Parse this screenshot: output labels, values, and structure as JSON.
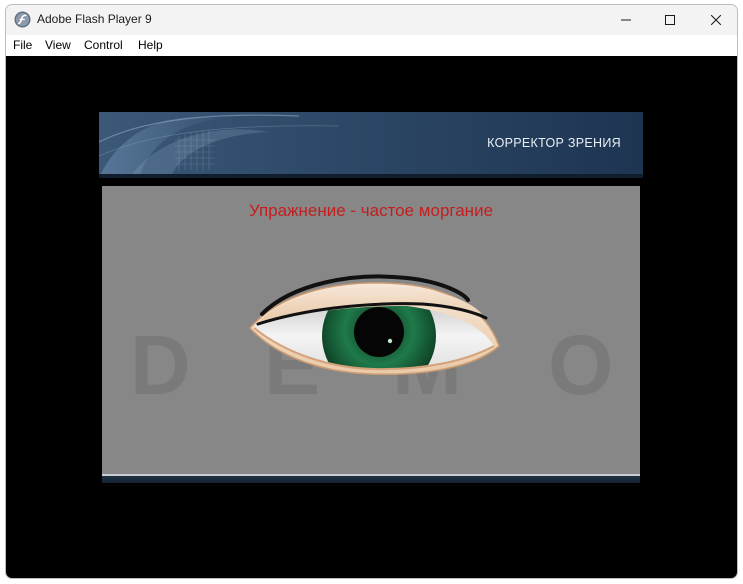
{
  "window": {
    "title": "Adobe Flash Player 9"
  },
  "menu": {
    "items": [
      "File",
      "View",
      "Control",
      "Help"
    ]
  },
  "flash": {
    "banner_title": "КОРРЕКТОР ЗРЕНИЯ",
    "exercise_title": "Упражнение - частое моргание",
    "watermark": [
      "D",
      "E",
      "M",
      "O"
    ]
  },
  "colors": {
    "stage_background": "#878787",
    "title_red": "#c41e1e",
    "iris_green": "#1f7a4a",
    "banner_blue": "#2c4866"
  },
  "icons": {
    "app": "flash-player-icon",
    "minimize": "minimize-icon",
    "maximize": "maximize-icon",
    "close": "close-icon"
  }
}
